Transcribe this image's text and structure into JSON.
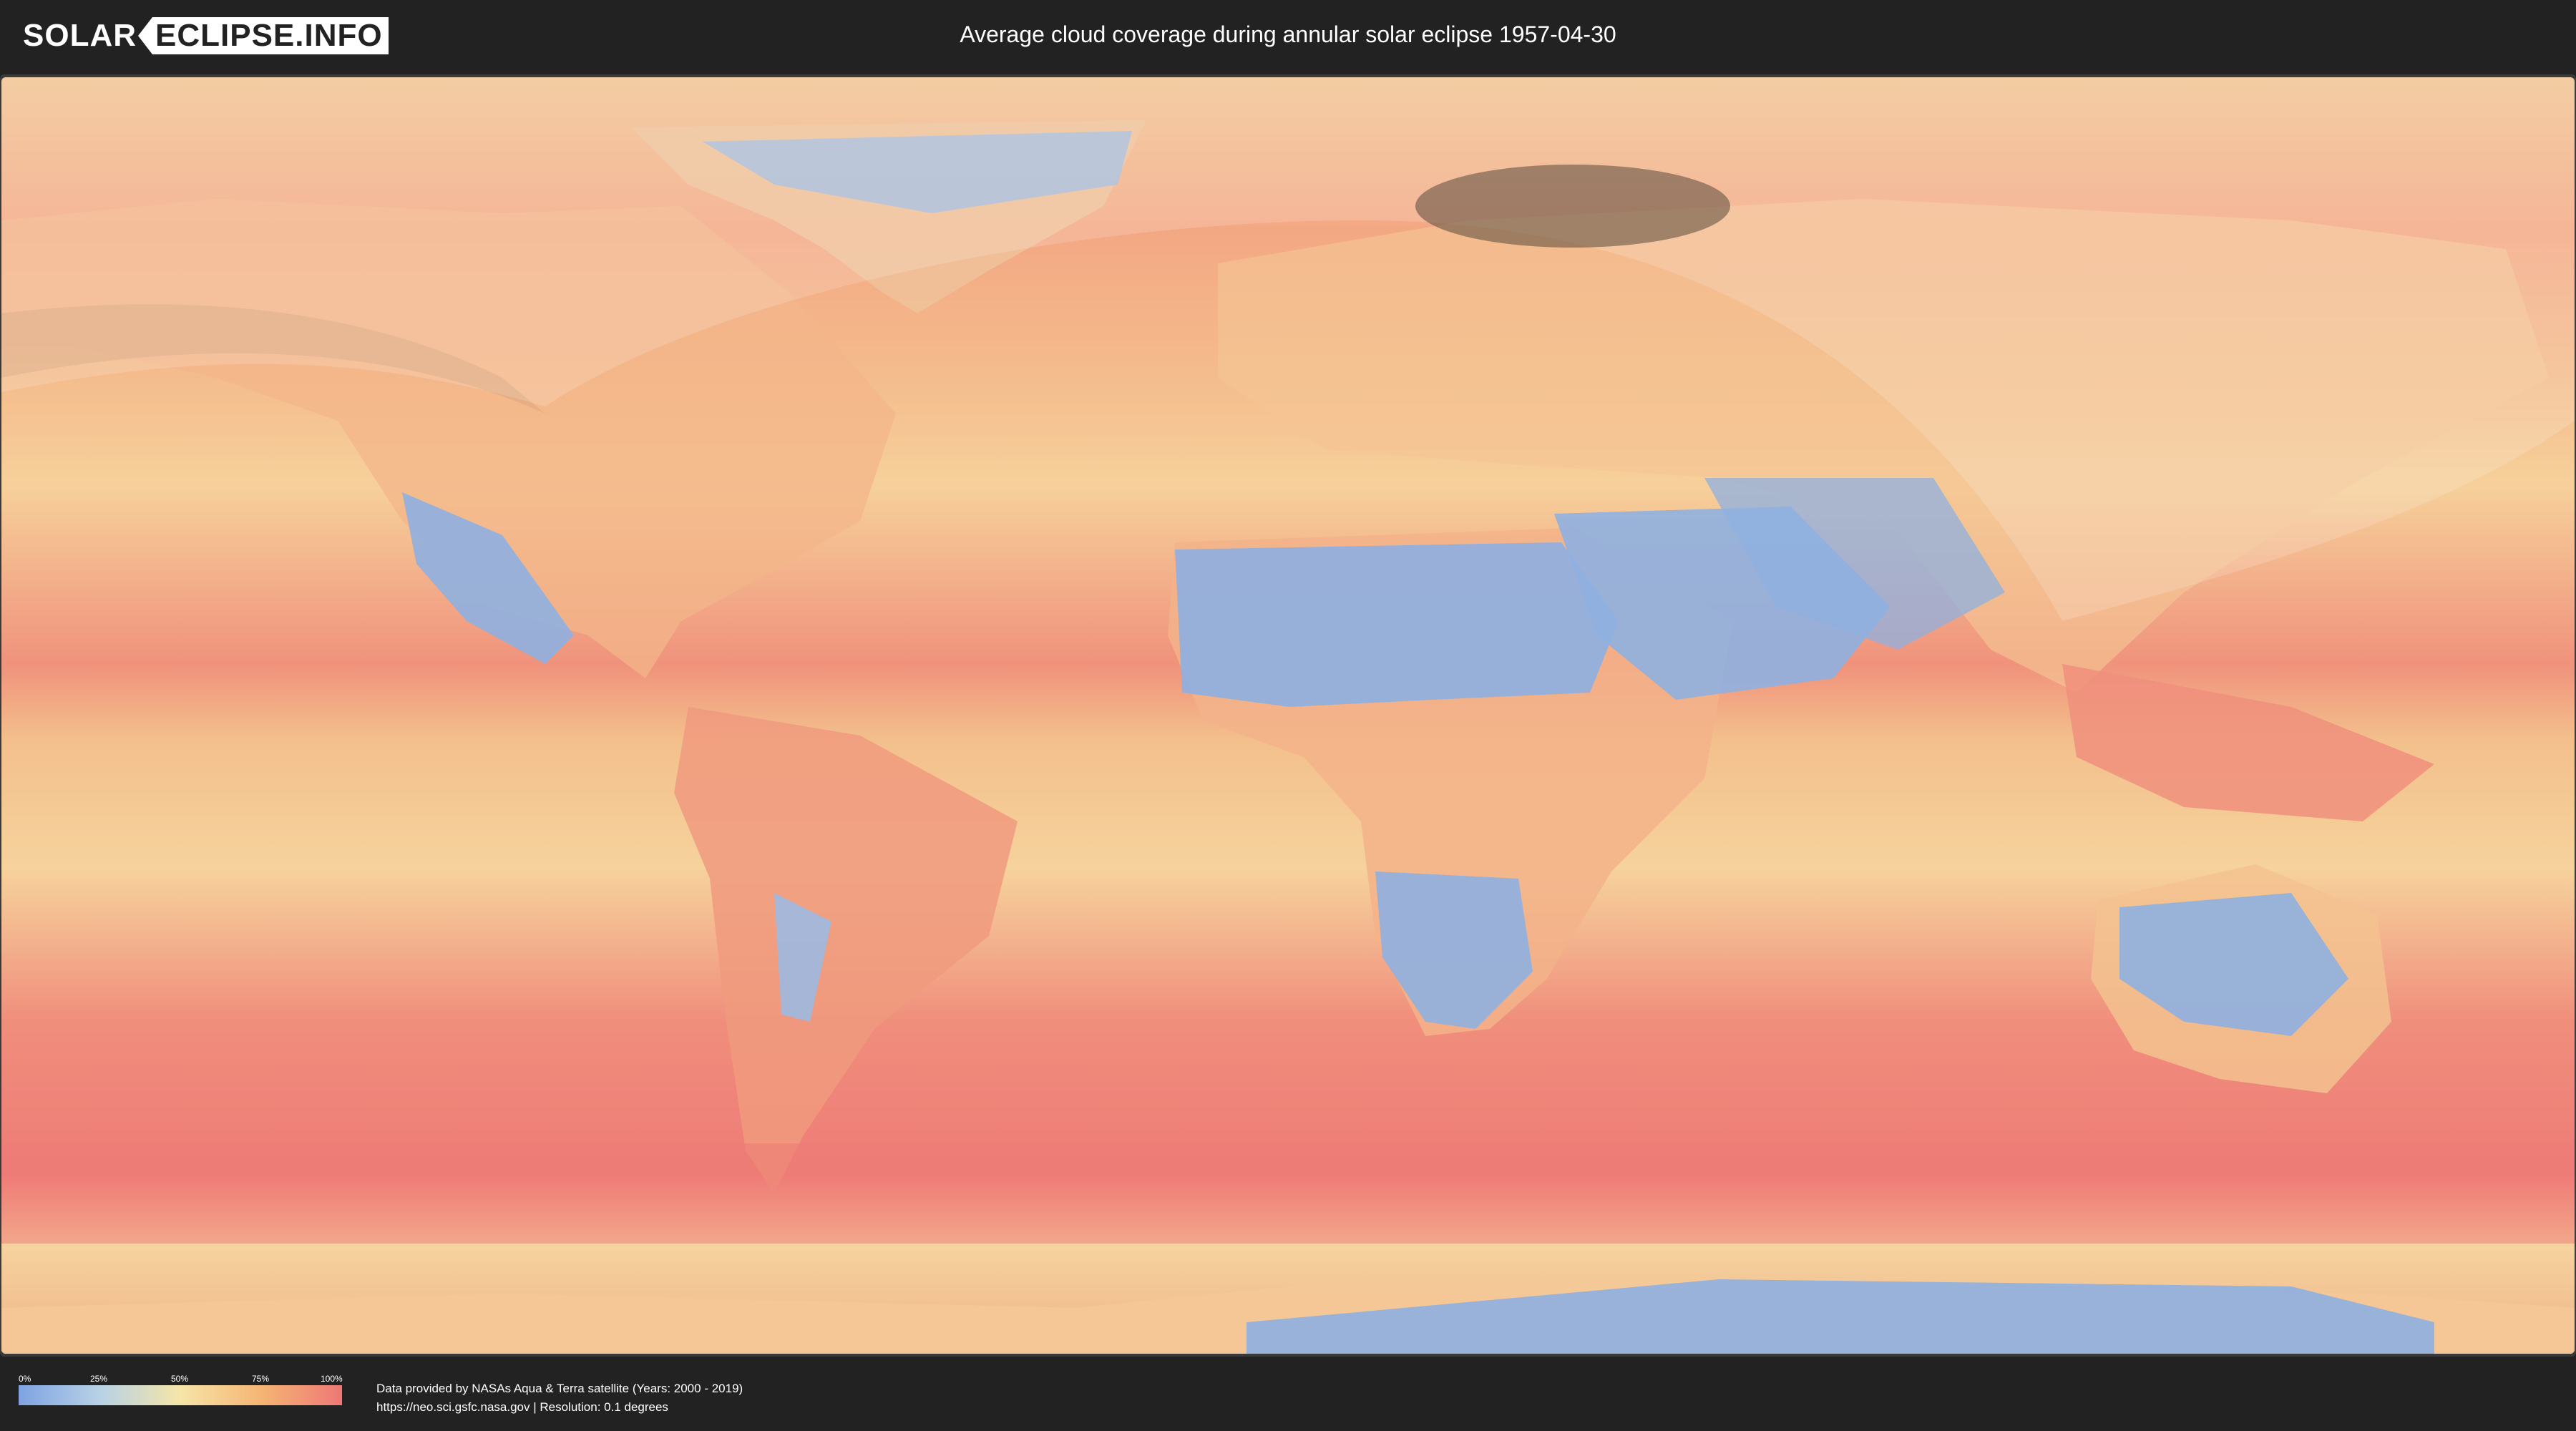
{
  "logo": {
    "part1": "SOLAR",
    "part2": "ECLIPSE.INFO"
  },
  "title": "Average cloud coverage during annular solar eclipse 1957-04-30",
  "map": {
    "icon": "world-cloud-map",
    "colors": {
      "ocean_cloudy": "#ef8a78",
      "mid": "#f5c58a",
      "clear": "#8fb0e0",
      "eclipse_overlay": "#ffffff",
      "path_shadow": "#5a4a3c"
    }
  },
  "legend": {
    "ticks": [
      "0%",
      "25%",
      "50%",
      "75%",
      "100%"
    ],
    "colors": [
      "#7fa3e3",
      "#b7d1e6",
      "#f6e5a8",
      "#f5b574",
      "#ee7876"
    ]
  },
  "credits": {
    "line1": "Data provided by NASAs Aqua & Terra satellite (Years: 2000 - 2019)",
    "line2": "https://neo.sci.gsfc.nasa.gov | Resolution: 0.1 degrees"
  }
}
